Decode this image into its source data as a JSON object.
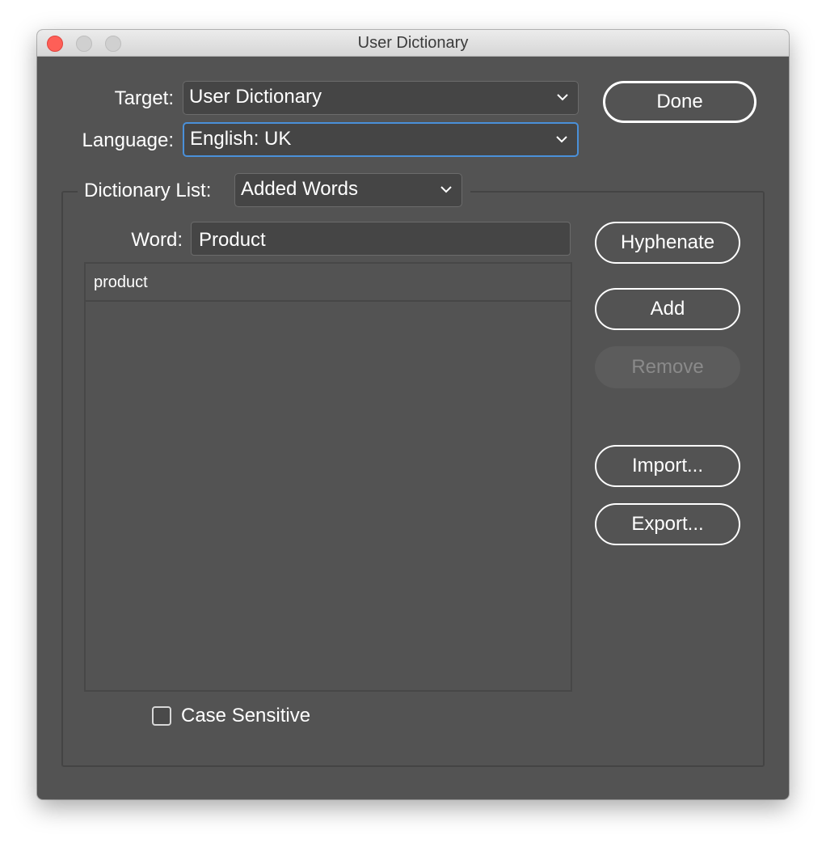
{
  "window": {
    "title": "User Dictionary"
  },
  "target": {
    "label": "Target:",
    "value": "User Dictionary"
  },
  "language": {
    "label": "Language:",
    "value": "English: UK"
  },
  "done_label": "Done",
  "dictionary_list": {
    "label": "Dictionary List:",
    "value": "Added Words"
  },
  "word": {
    "label": "Word:",
    "value": "Product"
  },
  "word_list": [
    "product"
  ],
  "buttons": {
    "hyphenate": "Hyphenate",
    "add": "Add",
    "remove": "Remove",
    "import": "Import...",
    "export": "Export..."
  },
  "case_sensitive": {
    "label": "Case Sensitive",
    "checked": false
  },
  "colors": {
    "panel": "#535353",
    "focus": "#4a90d9",
    "close": "#fe5f57"
  }
}
